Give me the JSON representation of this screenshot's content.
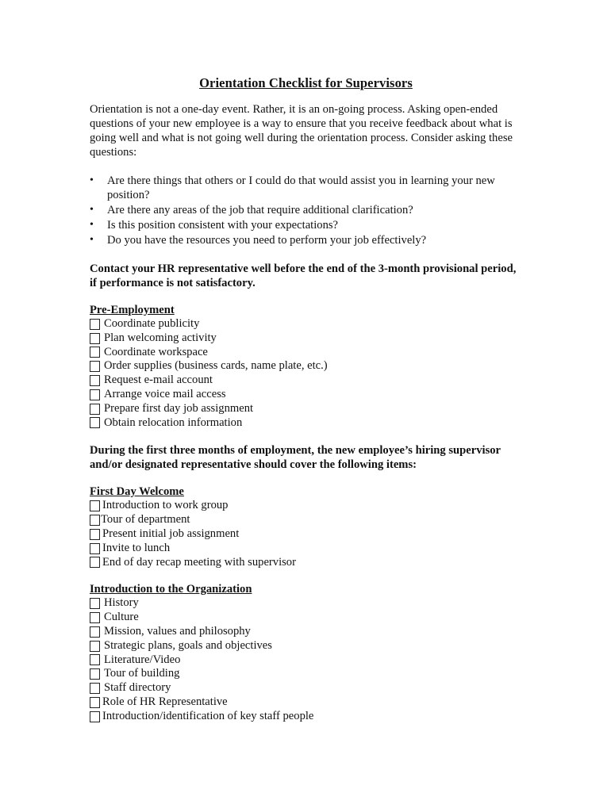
{
  "document": {
    "title": "Orientation Checklist for Supervisors",
    "intro": "Orientation is not a one-day event.  Rather, it is an on-going process.  Asking open-ended questions of your new employee is a way to ensure that you receive feedback about what is going well and what is not going well during the orientation process.  Consider asking these questions:",
    "bullet_glyph": "•",
    "questions": [
      "Are there things that others or I could do that would assist you in learning your new position?",
      "Are there any areas of the job that require additional clarification?",
      "Is this position consistent with your expectations?",
      "Do you have the resources you need to perform your job effectively?"
    ],
    "hr_note": "Contact your HR representative well before the end of the 3-month provisional period, if performance is not satisfactory.",
    "during_note": "During the first three months of employment, the new employee’s hiring supervisor and/or designated representative should cover the following items:",
    "sections": {
      "pre_employment": {
        "title": "Pre-Employment",
        "items": [
          {
            "label": "Coordinate publicity",
            "checked": false
          },
          {
            "label": "Plan welcoming activity",
            "checked": false
          },
          {
            "label": "Coordinate workspace",
            "checked": false
          },
          {
            "label": "Order supplies (business cards, name plate, etc.)",
            "checked": false
          },
          {
            "label": "Request e-mail account",
            "checked": false
          },
          {
            "label": "Arrange voice mail access",
            "checked": false
          },
          {
            "label": "Prepare first day job assignment",
            "checked": false
          },
          {
            "label": "Obtain relocation information",
            "checked": false
          }
        ]
      },
      "first_day": {
        "title": "First Day Welcome",
        "items": [
          {
            "label": "Introduction to work group",
            "checked": false
          },
          {
            "label": "Tour of department",
            "checked": false
          },
          {
            "label": "Present initial job assignment",
            "checked": false
          },
          {
            "label": "Invite to lunch",
            "checked": false
          },
          {
            "label": "End of day recap meeting with supervisor",
            "checked": false
          }
        ]
      },
      "organization": {
        "title": "Introduction to the Organization",
        "items": [
          {
            "label": "History",
            "checked": false
          },
          {
            "label": "Culture",
            "checked": false
          },
          {
            "label": "Mission, values and philosophy",
            "checked": false
          },
          {
            "label": "Strategic plans, goals and objectives",
            "checked": false
          },
          {
            "label": "Literature/Video",
            "checked": false
          },
          {
            "label": "Tour of building",
            "checked": false
          },
          {
            "label": "Staff directory",
            "checked": false
          },
          {
            "label": "Role of HR Representative",
            "checked": false
          },
          {
            "label": "Introduction/identification of key staff people",
            "checked": false
          }
        ]
      }
    }
  }
}
